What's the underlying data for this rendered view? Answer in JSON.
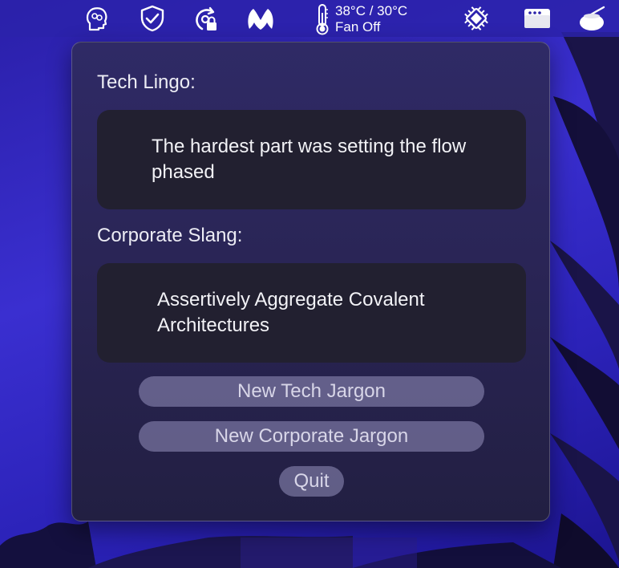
{
  "menubar": {
    "icons": [
      "brain-head-icon",
      "shield-check-icon",
      "lock-refresh-icon",
      "malwarebytes-icon",
      "thermometer-icon",
      "cpu-chip-icon",
      "window-dots-icon",
      "bowl-icon"
    ],
    "temperature": {
      "reading": "38°C / 30°C",
      "fan": "Fan Off"
    }
  },
  "popover": {
    "tech_label": "Tech Lingo:",
    "tech_text": "The hardest part was setting the flow phased",
    "corporate_label": "Corporate Slang:",
    "corporate_text": "Assertively Aggregate Covalent Architectures",
    "buttons": {
      "new_tech": "New Tech Jargon",
      "new_corporate": "New Corporate Jargon",
      "quit": "Quit"
    }
  },
  "colors": {
    "wallpaper": "#3a2fd0",
    "popover_bg": "#2a2556",
    "text_box_bg": "#222030",
    "button_bg": "#7f7aa8"
  }
}
